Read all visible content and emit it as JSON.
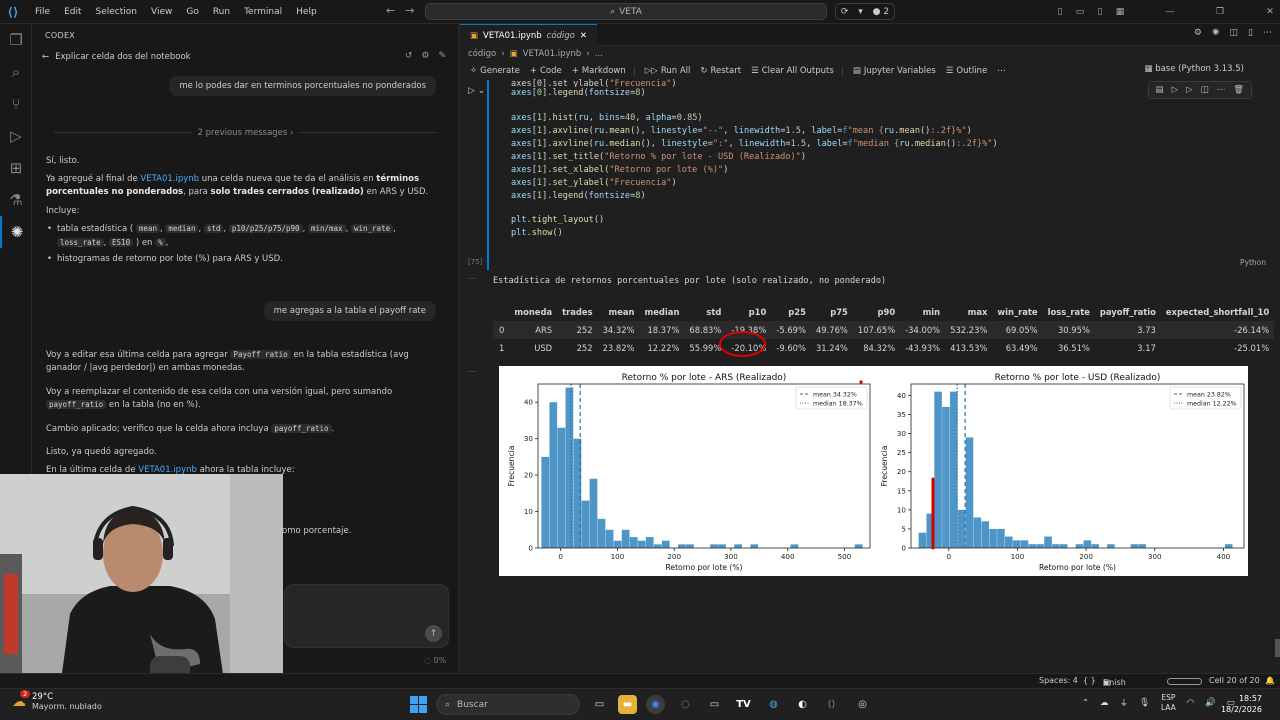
{
  "menu": [
    "File",
    "Edit",
    "Selection",
    "View",
    "Go",
    "Run",
    "Terminal",
    "Help"
  ],
  "command_center": "VETA",
  "copilot_badge": "2",
  "sidepanel": {
    "title": "CODEX",
    "thread_title": "Explicar celda dos del notebook",
    "user_msg_1": "me lo podes dar en terminos porcentuales no ponderados",
    "previous_messages": "2 previous messages",
    "reply_1": "Sí, listo.",
    "reply_2_a": "Ya agregué al final de ",
    "notebook_link": "VETA01.ipynb",
    "reply_2_b": " una celda nueva que te da el análisis en ",
    "reply_2_bold1": "términos porcentuales no ponderados",
    "reply_2_c": ", para ",
    "reply_2_bold2": "solo trades cerrados (realizado)",
    "reply_2_d": " en ARS y USD.",
    "incluye": "Incluye:",
    "bullet1_prefix": "tabla estadística (",
    "bullet1_codes": [
      "mean",
      "median",
      "std",
      "p10/p25/p75/p90",
      "min/max",
      "win_rate",
      "loss_rate",
      "ES10"
    ],
    "bullet1_mid": ") en",
    "bullet1_pct": "%",
    "bullet2": "histogramas de retorno por lote (%) para ARS y USD.",
    "user_msg_2": "me agregas a la tabla el payoff rate",
    "reply_3_a": "Voy a editar esa última celda para agregar ",
    "reply_3_code": "Payoff ratio",
    "reply_3_b": " en la tabla estadística (avg ganador / |avg perdedor|) en ambas monedas.",
    "reply_4_a": "Voy a reemplazar el contenido de esa celda con una versión igual, pero sumando ",
    "reply_4_code": "payoff_ratio",
    "reply_4_b": " en la tabla (no en %).",
    "reply_5_a": "Cambio aplicado; verifico que la celda ahora incluya ",
    "reply_5_code": "payoff_ratio",
    "reply_5_b": ".",
    "reply_6": "Listo, ya quedó agregado.",
    "reply_7_a": "En la última celda de ",
    "reply_7_b": " ahora la tabla incluye:",
    "reply_8_fragment": "omo porcentaje.",
    "context_pct": "0%"
  },
  "editor": {
    "tab_label": "VETA01.ipynb",
    "tab_sub": "código",
    "breadcrumb": [
      "código",
      "VETA01.ipynb",
      "..."
    ],
    "toolbar": [
      "Generate",
      "Code",
      "Markdown",
      "Run All",
      "Restart",
      "Clear All Outputs",
      "Jupyter Variables",
      "Outline"
    ],
    "kernel": "base (Python 3.13.5)",
    "cell_exec": "[75]",
    "cell_lang": "Python",
    "output_title": "Estadística de retornos porcentuales por lote (solo realizado, no ponderado)"
  },
  "stats_table": {
    "columns": [
      "",
      "moneda",
      "trades",
      "mean",
      "median",
      "std",
      "p10",
      "p25",
      "p75",
      "p90",
      "min",
      "max",
      "win_rate",
      "loss_rate",
      "payoff_ratio",
      "expected_shortfall_10"
    ],
    "rows": [
      [
        "0",
        "ARS",
        "252",
        "34.32%",
        "18.37%",
        "68.83%",
        "-19.38%",
        "-5.69%",
        "49.76%",
        "107.65%",
        "-34.00%",
        "532.23%",
        "69.05%",
        "30.95%",
        "3.73",
        "-26.14%"
      ],
      [
        "1",
        "USD",
        "252",
        "23.82%",
        "12.22%",
        "55.99%",
        "-20.10%",
        "-9.60%",
        "31.24%",
        "84.32%",
        "-43.93%",
        "413.53%",
        "63.49%",
        "36.51%",
        "3.17",
        "-25.01%"
      ]
    ]
  },
  "chart_data": [
    {
      "type": "bar",
      "title": "Retorno % por lote - ARS (Realizado)",
      "xlabel": "Retorno por lote (%)",
      "ylabel": "Frecuencia",
      "xlim": [
        -40,
        545
      ],
      "ylim": [
        0,
        45
      ],
      "xticks": [
        0,
        100,
        200,
        300,
        400,
        500
      ],
      "yticks": [
        0,
        10,
        20,
        30,
        40
      ],
      "bin_start": -34.0,
      "bin_width": 14.16,
      "values": [
        25,
        40,
        33,
        44,
        30,
        13,
        19,
        8,
        5,
        2,
        5,
        3,
        2,
        3,
        1,
        2,
        0,
        1,
        1,
        0,
        0,
        1,
        1,
        0,
        1,
        0,
        1,
        0,
        0,
        0,
        0,
        1,
        0,
        0,
        0,
        0,
        0,
        0,
        0,
        1
      ],
      "color": "#3b8bc2",
      "vlines": [
        {
          "label": "mean 34.32%",
          "x": 34.32,
          "style": "dashed"
        },
        {
          "label": "median 18.37%",
          "x": 18.37,
          "style": "dotted"
        }
      ],
      "legend": "top-right",
      "grid": false
    },
    {
      "type": "bar",
      "title": "Retorno % por lote - USD (Realizado)",
      "xlabel": "Retorno por lote (%)",
      "ylabel": "Frecuencia",
      "xlim": [
        -55,
        430
      ],
      "ylim": [
        0,
        43
      ],
      "xticks": [
        0,
        100,
        200,
        300,
        400
      ],
      "yticks": [
        0,
        5,
        10,
        15,
        20,
        25,
        30,
        35,
        40
      ],
      "bin_start": -43.93,
      "bin_width": 11.44,
      "values": [
        4,
        9,
        41,
        37,
        41,
        10,
        29,
        8,
        7,
        5,
        5,
        3,
        2,
        2,
        1,
        1,
        3,
        1,
        1,
        0,
        1,
        2,
        1,
        0,
        1,
        0,
        0,
        1,
        1,
        0,
        0,
        0,
        0,
        0,
        0,
        0,
        0,
        0,
        0,
        1
      ],
      "color": "#3b8bc2",
      "vlines": [
        {
          "label": "mean 23.82%",
          "x": 23.82,
          "style": "dashed"
        },
        {
          "label": "median 12.22%",
          "x": 12.22,
          "style": "dotted"
        }
      ],
      "legend": "top-right",
      "grid": false
    }
  ],
  "statusbar": {
    "spaces": "Spaces: 4",
    "braces": "{ }",
    "finish_setup": "Finish Setup",
    "cell": "Cell 20 of 20"
  },
  "taskbar": {
    "temperature": "29°C",
    "weather": "Mayorm. nublado",
    "weather_badge": "2",
    "search": "Buscar",
    "lang1": "ESP",
    "lang2": "LAA",
    "time": "18:57",
    "date": "18/2/2026"
  }
}
